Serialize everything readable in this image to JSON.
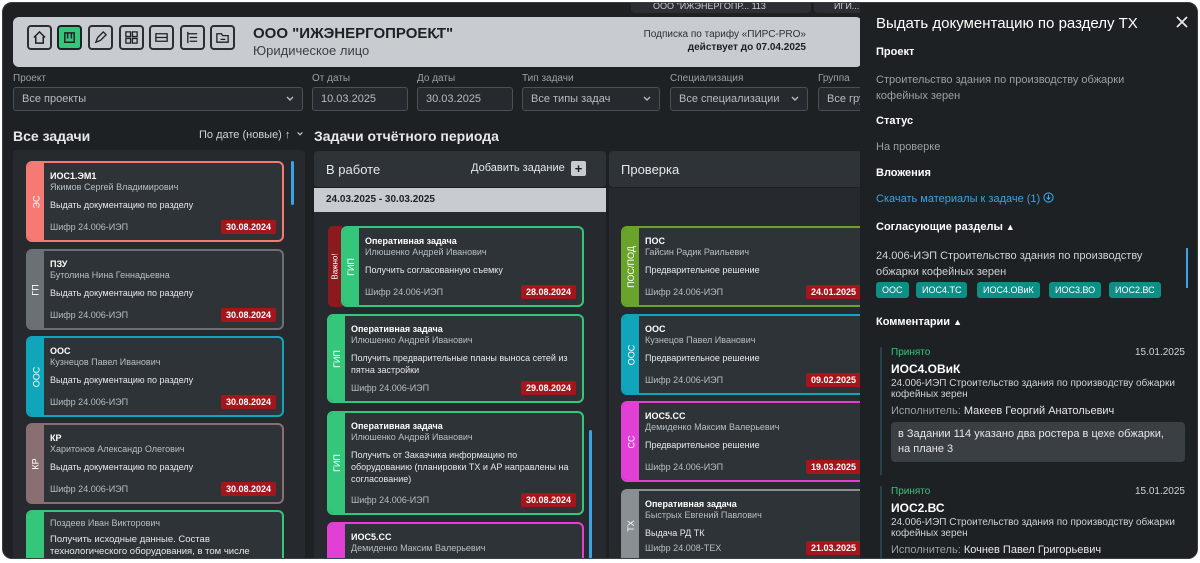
{
  "header": {
    "org_name": "ООО \"ИЖЭНЕРГОПРОЕКТ\"",
    "org_type": "Юридическое лицо",
    "subscription_line": "Подписка по тарифу «ПИРС-PRO»",
    "subscription_until": "действует до 07.04.2025",
    "user_chip_1": "ООО \"ИЖЭНЕРГОПР... 113",
    "user_chip_2": "ИГИ..."
  },
  "filters": {
    "project": {
      "label": "Проект",
      "value": "Все проекты"
    },
    "date_from": {
      "label": "От даты",
      "value": "10.03.2025"
    },
    "date_to": {
      "label": "До даты",
      "value": "30.03.2025"
    },
    "task_type": {
      "label": "Тип задачи",
      "value": "Все типы задач"
    },
    "specialization": {
      "label": "Специализация",
      "value": "Все специализации"
    },
    "group": {
      "label": "Группа",
      "value": "Все гру"
    }
  },
  "all_tasks": {
    "title": "Все задачи",
    "sort_label": "По дате (новые) ↑",
    "cards": [
      {
        "strip": "ЭС",
        "code": "ИОС1.ЭМ1",
        "person": "Якимов Сергей Владимирович",
        "desc": "Выдать документацию по разделу",
        "cipher": "Шифр 24.006-ИЭП",
        "date": "30.08.2024"
      },
      {
        "strip": "ГП",
        "code": "ПЗУ",
        "person": "Бутолина Нина Геннадьевна",
        "desc": "Выдать документацию по разделу",
        "cipher": "Шифр 24.006-ИЭП",
        "date": "30.08.2024"
      },
      {
        "strip": "ООС",
        "code": "ООС",
        "person": "Кузнецов Павел Иванович",
        "desc": "Выдать документацию по разделу",
        "cipher": "Шифр 24.006-ИЭП",
        "date": "30.08.2024"
      },
      {
        "strip": "КР",
        "code": "КР",
        "person": "Харитонов Александр Олегович",
        "desc": "Выдать документацию по разделу",
        "cipher": "Шифр 24.006-ИЭП",
        "date": "30.08.2024"
      },
      {
        "strip": "",
        "code": "",
        "person": "Поздеев Иван Викторович",
        "desc": "Получить исходные данные. Состав технологического оборудования, в том числе",
        "cipher": "",
        "date": ""
      }
    ]
  },
  "period": {
    "title": "Задачи отчётного периода",
    "in_progress": {
      "title": "В работе",
      "add_label": "Добавить задание"
    },
    "review": {
      "title": "Проверка"
    },
    "week": "24.03.2025 - 30.03.2025",
    "work_cards": [
      {
        "flag": "Важно!",
        "strip": "ГИП",
        "code": "Оперативная задача",
        "person": "Илюшенко Андрей Иванович",
        "desc": "Получить согласованную съемку",
        "cipher": "Шифр 24.006-ИЭП",
        "date": "28.08.2024"
      },
      {
        "strip": "ГИП",
        "code": "Оперативная задача",
        "person": "Илюшенко Андрей Иванович",
        "desc": "Получить предварительные планы выноса сетей из пятна застройки",
        "cipher": "Шифр 24.006-ИЭП",
        "date": "29.08.2024"
      },
      {
        "strip": "ГИП",
        "code": "Оперативная задача",
        "person": "Илюшенко Андрей Иванович",
        "desc": "Получить от Заказчика информацию по оборудованию (планировки ТХ и АР направлены на согласование)",
        "cipher": "Шифр 24.006-ИЭП",
        "date": "30.08.2024"
      },
      {
        "strip": "",
        "code": "ИОС5.СС",
        "person": "Демиденко Максим Валерьевич",
        "desc": "",
        "cipher": "",
        "date": ""
      }
    ],
    "review_cards": [
      {
        "strip": "ПОС/ПОД",
        "code": "ПОС",
        "person": "Гайсин Радик Раильевич",
        "desc": "Предварительное решение",
        "cipher": "Шифр 24.006-ИЭП",
        "date": "24.01.2025"
      },
      {
        "strip": "ООС",
        "code": "ООС",
        "person": "Кузнецов Павел Иванович",
        "desc": "Предварительное решение",
        "cipher": "Шифр 24.006-ИЭП",
        "date": "09.02.2025"
      },
      {
        "strip": "СС",
        "code": "ИОС5.СС",
        "person": "Демиденко Максим Валерьевич",
        "desc": "Предварительное решение",
        "cipher": "Шифр 24.006-ИЭП",
        "date": "19.03.2025"
      },
      {
        "strip": "ТХ",
        "code": "Оперативная задача",
        "person": "Быстрых Евгений Павлович",
        "desc": "Выдача РД ТК",
        "cipher": "Шифр 24.008-ТЕХ",
        "date": "21.03.2025"
      }
    ]
  },
  "panel": {
    "title": "Выдать документацию по разделу ТХ",
    "project_label": "Проект",
    "project_value": "Строительство здания по производству обжарки кофейных зерен",
    "status_label": "Статус",
    "status_value": "На проверке",
    "attachments_label": "Вложения",
    "download_link": "Скачать материалы к задаче (1)",
    "approving_label": "Согласующие разделы",
    "approving_value": "24.006-ИЭП Строительство здания по производству обжарки кофейных зерен",
    "tags": [
      "ООС",
      "ИОС4.ТС",
      "ИОС4.ОВиК",
      "ИОС3.ВО",
      "ИОС2.ВС"
    ],
    "comments_label": "Комментарии",
    "comments": [
      {
        "status": "Принято",
        "date": "15.01.2025",
        "code": "ИОС4.ОВиК",
        "project": "24.006-ИЭП Строительство здания по производству обжарки кофейных зерен",
        "executor_label": "Исполнитель:",
        "executor": "Макеев Георгий Анатольевич",
        "text": "в Задании 114 указано два ростера в цехе обжарки, на плане 3"
      },
      {
        "status": "Принято",
        "date": "15.01.2025",
        "code": "ИОС2.ВС",
        "project": "24.006-ИЭП Строительство здания по производству обжарки кофейных зерен",
        "executor_label": "Исполнитель:",
        "executor": "Кочнев Павел Григорьевич",
        "text": ""
      }
    ]
  },
  "colors": {
    "accent": "#34c77b",
    "link": "#3aa4e6",
    "tag": "#0e8f86",
    "date_badge": "#a3161b"
  }
}
